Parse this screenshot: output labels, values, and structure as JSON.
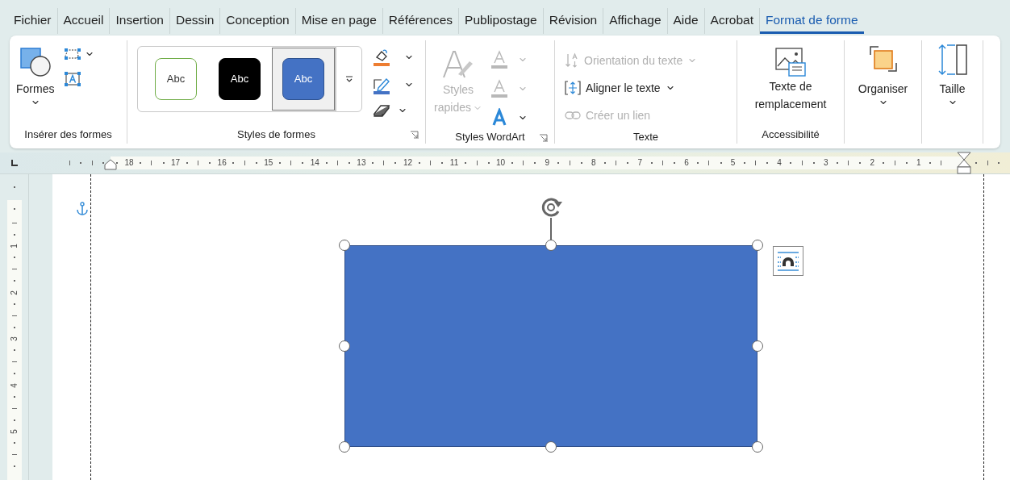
{
  "tabs": [
    {
      "label": "Fichier",
      "selected": false
    },
    {
      "label": "Accueil",
      "selected": false
    },
    {
      "label": "Insertion",
      "selected": false
    },
    {
      "label": "Dessin",
      "selected": false
    },
    {
      "label": "Conception",
      "selected": false
    },
    {
      "label": "Mise en page",
      "selected": false
    },
    {
      "label": "Références",
      "selected": false
    },
    {
      "label": "Publipostage",
      "selected": false
    },
    {
      "label": "Révision",
      "selected": false
    },
    {
      "label": "Affichage",
      "selected": false
    },
    {
      "label": "Aide",
      "selected": false
    },
    {
      "label": "Acrobat",
      "selected": false
    },
    {
      "label": "Format de forme",
      "selected": true
    }
  ],
  "ribbon": {
    "insert_shapes": {
      "label": "Insérer des formes",
      "shapes_button": "Formes"
    },
    "shape_styles": {
      "label": "Styles de formes",
      "presets": [
        {
          "label": "Abc",
          "kind": "outline",
          "selected": false
        },
        {
          "label": "Abc",
          "kind": "dark",
          "selected": false
        },
        {
          "label": "Abc",
          "kind": "blue",
          "selected": true
        }
      ]
    },
    "wordart_styles": {
      "label": "Styles WordArt",
      "quick_styles": {
        "label": "Styles rapides",
        "disabled": true
      },
      "text_fill": {
        "disabled": true
      },
      "text_outline": {
        "disabled": true
      },
      "text_effects": {
        "disabled": false
      }
    },
    "text": {
      "label": "Texte",
      "items": [
        {
          "kind": "orientation",
          "label": "Orientation du texte",
          "disabled": true
        },
        {
          "kind": "align",
          "label": "Aligner le texte",
          "disabled": false
        },
        {
          "kind": "link",
          "label": "Créer un lien",
          "disabled": true
        }
      ]
    },
    "accessibility": {
      "label": "Accessibilité",
      "alt_text_button": "Texte de remplacement"
    },
    "arrange_button": "Organiser",
    "size_button": "Taille"
  },
  "horizontal_ruler": [
    "18",
    "17",
    "16",
    "15",
    "14",
    "13",
    "12",
    "11",
    "10",
    "9",
    "8",
    "7",
    "6",
    "5",
    "4",
    "3",
    "2",
    "1"
  ],
  "vertical_ruler": [
    "1",
    "2",
    "3",
    "4",
    "5"
  ]
}
